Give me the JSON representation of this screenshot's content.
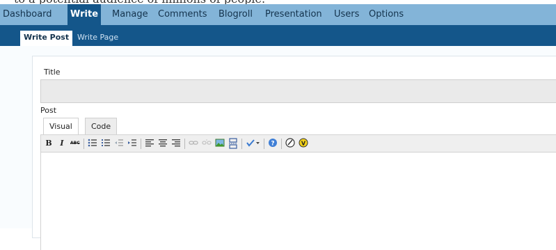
{
  "main_nav": {
    "items": [
      {
        "label": "Dashboard"
      },
      {
        "label": "Write"
      },
      {
        "label": "Manage"
      },
      {
        "label": "Comments"
      },
      {
        "label": "Blogroll"
      },
      {
        "label": "Presentation"
      },
      {
        "label": "Users"
      },
      {
        "label": "Options"
      }
    ],
    "active": "Write"
  },
  "sub_nav": {
    "items": [
      {
        "label": "Write Post"
      },
      {
        "label": "Write Page"
      }
    ],
    "active": "Write Post"
  },
  "form": {
    "title_label": "Title",
    "title_value": "",
    "post_label": "Post",
    "tabs": [
      {
        "label": "Visual"
      },
      {
        "label": "Code"
      }
    ],
    "active_tab": "Visual",
    "toolbar": {
      "bold_label": "B",
      "italic_label": "I",
      "strikethrough_label": "ABC",
      "icons": [
        "bold-icon",
        "italic-icon",
        "strikethrough-icon",
        "bulleted-list-icon",
        "numbered-list-icon",
        "outdent-icon",
        "indent-icon",
        "align-left-icon",
        "align-center-icon",
        "align-right-icon",
        "link-icon",
        "unlink-icon",
        "insert-image-icon",
        "more-tag-icon",
        "spellcheck-icon",
        "help-icon",
        "wordpress-icon",
        "v-icon"
      ]
    }
  },
  "colors": {
    "main_nav_bg": "#83b4d8",
    "sub_nav_bg": "#14568a",
    "active_main_item_bg": "#14568a"
  }
}
